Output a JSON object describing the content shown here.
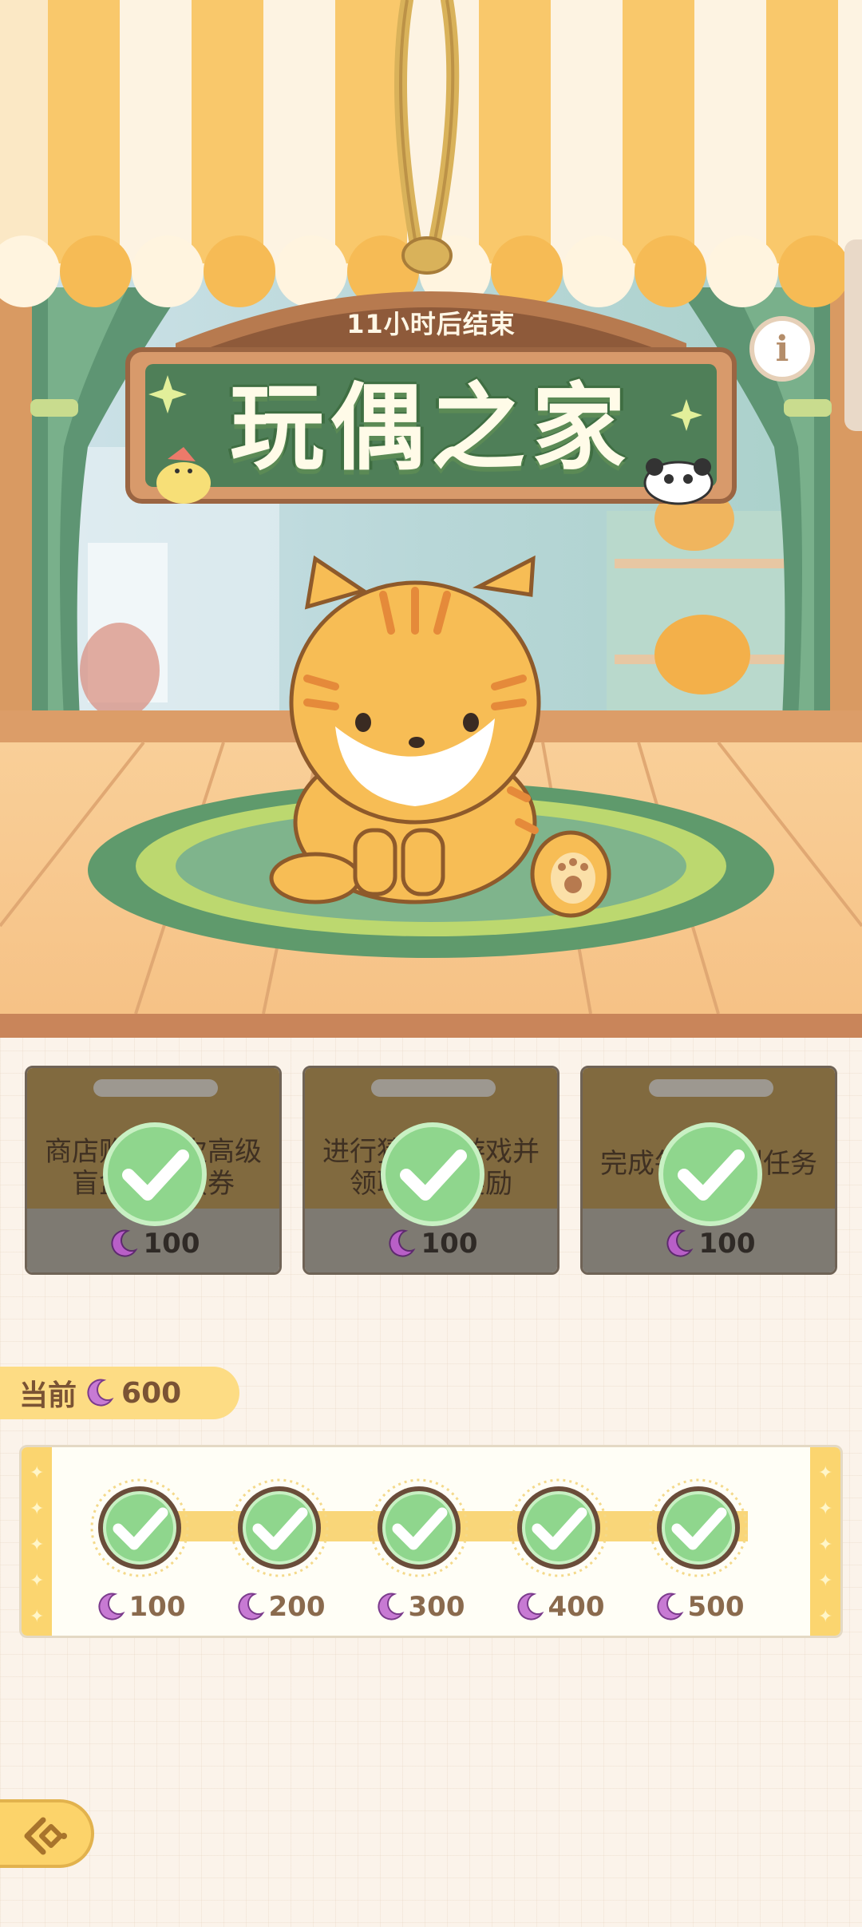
{
  "event": {
    "countdown": "11小时后结束",
    "title": "玩偶之家",
    "info_icon": "info-icon"
  },
  "tasks": [
    {
      "text": "商店购买一次高级盲盒或扭蛋券",
      "reward": "100",
      "status": "completed"
    },
    {
      "text": "进行猜小球游戏并领取一次奖励",
      "reward": "100",
      "status": "completed"
    },
    {
      "text": "完成每日签到任务",
      "reward": "100",
      "status": "completed"
    }
  ],
  "current": {
    "label": "当前",
    "value": "600"
  },
  "milestones": [
    {
      "value": "100",
      "status": "claimed"
    },
    {
      "value": "200",
      "status": "claimed"
    },
    {
      "value": "300",
      "status": "claimed"
    },
    {
      "value": "400",
      "status": "claimed"
    },
    {
      "value": "500",
      "status": "claimed"
    }
  ],
  "colors": {
    "accent": "#fcd36a",
    "check": "#9be29a",
    "moon": "#b85fc7"
  },
  "icons": {
    "currency": "moon-icon",
    "completed": "checkmark-icon",
    "back": "back-arrow-icon"
  }
}
